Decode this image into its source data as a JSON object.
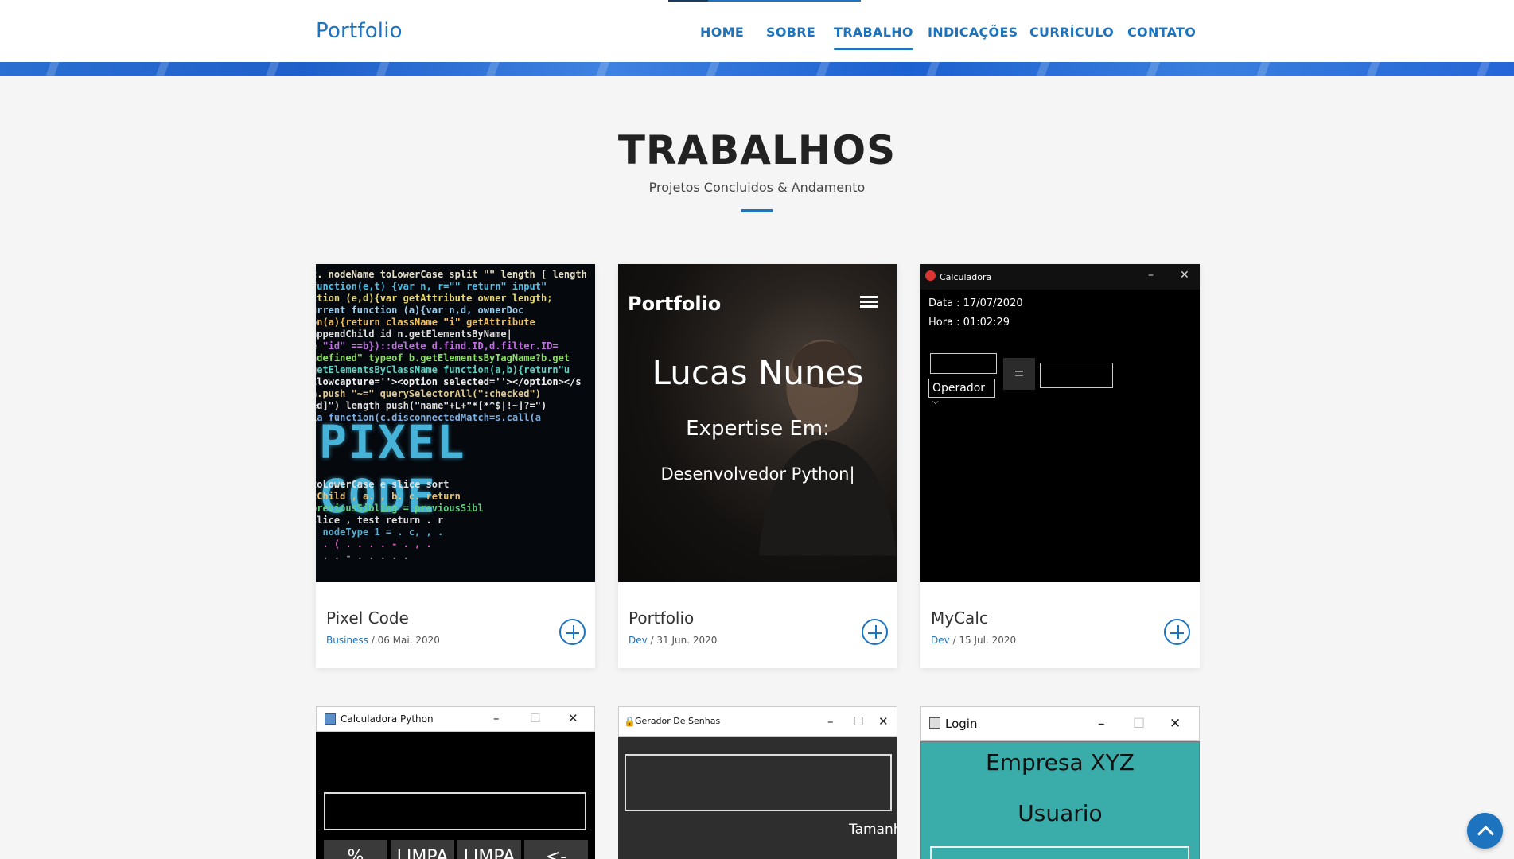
{
  "nav": {
    "brand": "Portfolio",
    "items": [
      "HOME",
      "SOBRE",
      "TRABALHO",
      "INDICAÇÕES",
      "CURRÍCULO",
      "CONTATO"
    ],
    "active": "TRABALHO"
  },
  "section": {
    "title": "TRABALHOS",
    "subtitle": "Projetos Concluidos & Andamento"
  },
  "cards": [
    {
      "title": "Pixel Code",
      "category": "Business",
      "date": " / 06 Mai. 2020",
      "image_text": "PIXEL CODE"
    },
    {
      "title": "Portfolio",
      "category": "Dev",
      "date": " / 31 Jun. 2020",
      "image": {
        "brand": "Portfolio",
        "name": "Lucas Nunes",
        "expertise": "Expertise Em:",
        "role": "Desenvolvedor Python|"
      }
    },
    {
      "title": "MyCalc",
      "category": "Dev",
      "date": " / 15 Jul. 2020",
      "image": {
        "window_title": "Calculadora",
        "date_line": "Data : 17/07/2020",
        "time_line": "Hora : 01:02:29",
        "operator": "Operador",
        "equals": "="
      }
    }
  ],
  "bottom_cards": [
    {
      "window_title": "Calculadora Python",
      "buttons": [
        "%",
        "LIMPA",
        "LIMPA",
        "<-"
      ]
    },
    {
      "window_title": "Gerador De Senhas",
      "label": "Tamanho"
    },
    {
      "window_title": "Login",
      "heading": "Empresa XYZ",
      "field_label": "Usuario"
    }
  ],
  "colors": {
    "accent": "#1e73be",
    "background": "#f5f5f5",
    "login_teal": "#3aadab"
  },
  "icons": {
    "card_action": "plus-circle-icon",
    "scroll_top": "chevron-up-icon"
  }
}
